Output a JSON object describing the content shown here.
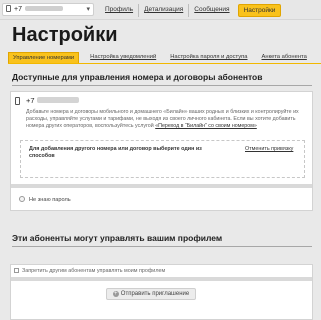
{
  "topbar": {
    "phone_prefix": "+7",
    "chevron": "▾",
    "nav": [
      "Профиль",
      "Детализация",
      "Сообщения"
    ],
    "active": "Настройки"
  },
  "page_title": "Настройки",
  "tabs": [
    "Управление номерами",
    "Настройка уведомлений",
    "Настройка пароля и доступа",
    "Анкета абонента"
  ],
  "section1": {
    "title": "Доступные для управления номера и договоры абонентов",
    "phone_prefix": "+7",
    "description": "Добавьте номера и договоры мобильного и домашнего «Билайн» ваших родных и близких и контролируйте их расходы, управляйте услугами и тарифами, не выходя из своего личного кабинета. Если вы хотите добавить номера других операторов, воспользуйтесь услугой",
    "link": "«Переход в “Билайн” со своим номером»",
    "add_box_text": "Для добавления другого номера или договор выберите один из способов",
    "cancel": "Отменить привязку",
    "radio_label": "Не знаю пароль"
  },
  "section2": {
    "title": "Эти абоненты могут управлять вашим профилем",
    "checkbox_label": "Запретить другим абонентам управлять моим профилем",
    "add_button": "Отправить приглашение"
  }
}
